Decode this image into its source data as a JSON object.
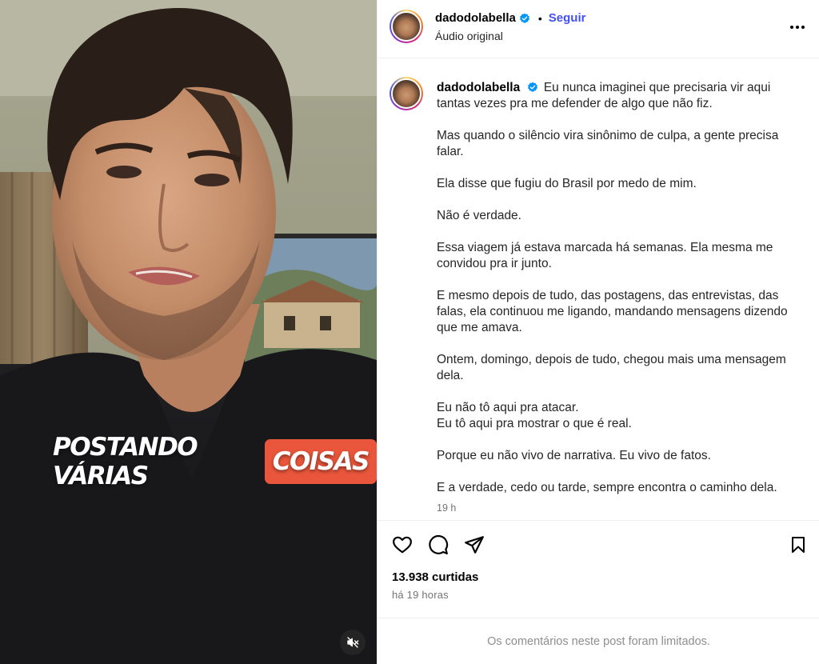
{
  "video": {
    "caption_words": [
      "POSTANDO VÁRIAS",
      "COISAS"
    ],
    "mute_icon": "speaker-muted-icon"
  },
  "header": {
    "username": "dadodolabella",
    "separator": "•",
    "follow_label": "Seguir",
    "audio_label": "Áudio original",
    "more_icon": "more-horizontal-icon"
  },
  "post": {
    "username": "dadodolabella",
    "paragraphs": [
      "Eu nunca imaginei que precisaria vir aqui tantas vezes pra me defender de algo que não fiz.",
      "Mas quando o silêncio vira sinônimo de culpa, a gente precisa falar.",
      "Ela disse que fugiu do Brasil por medo de mim.",
      "Não é verdade.",
      "Essa viagem já estava marcada há semanas. Ela mesma me convidou pra ir junto.",
      "E mesmo depois de tudo, das postagens, das entrevistas, das falas, ela continuou me ligando, mandando mensagens dizendo que me amava.",
      "Ontem, domingo, depois de tudo, chegou mais uma mensagem dela.",
      "Eu não tô aqui pra atacar.",
      "Eu tô aqui pra mostrar o que é real.",
      "Porque eu não vivo de narrativa. Eu vivo de fatos.",
      "E a verdade, cedo ou tarde, sempre encontra o caminho dela."
    ],
    "time": "19 h"
  },
  "actions": {
    "likes": "13.938 curtidas",
    "ago": "há 19 horas"
  },
  "comments": {
    "limited_text": "Os comentários neste post foram limitados."
  },
  "colors": {
    "accent": "#4150f7",
    "caption_highlight": "#e9563b",
    "verified": "#0095f6"
  }
}
